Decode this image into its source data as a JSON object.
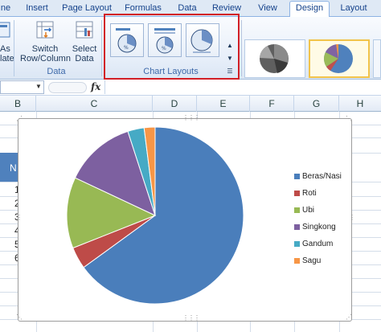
{
  "ribbon_tabs": [
    "ne",
    "Insert",
    "Page Layout",
    "Formulas",
    "Data",
    "Review",
    "View",
    "Design",
    "Layout"
  ],
  "active_tab": "Design",
  "ribbon": {
    "save_as_label_1": "As",
    "save_as_label_2": "late",
    "switch_label_1": "Switch",
    "switch_label_2": "Row/Column",
    "select_label_1": "Select",
    "select_label_2": "Data",
    "data_group_label": "Data",
    "chart_layouts_label": "Chart Layouts"
  },
  "formula_bar": {
    "fx": "fx",
    "value": ""
  },
  "columns": [
    "B",
    "C",
    "D",
    "E",
    "F",
    "G",
    "H"
  ],
  "grid": {
    "header_cell_text": "N",
    "row_digits": [
      "1",
      "2",
      "3",
      "4",
      "5",
      "6"
    ]
  },
  "colors": {
    "accent": "#d21f26",
    "ribbon_tab_bg": "#dfe9f5",
    "selected_style_border": "#f1c34a"
  },
  "chart_data": {
    "type": "pie",
    "categories": [
      "Beras/Nasi",
      "Roti",
      "Ubi",
      "Singkong",
      "Gandum",
      "Sagu"
    ],
    "values": [
      65,
      4,
      13,
      13,
      3,
      2
    ],
    "colors": [
      "#4a7ebb",
      "#be4b48",
      "#98b954",
      "#7d60a0",
      "#46aac5",
      "#f79646"
    ],
    "legend_position": "right"
  }
}
